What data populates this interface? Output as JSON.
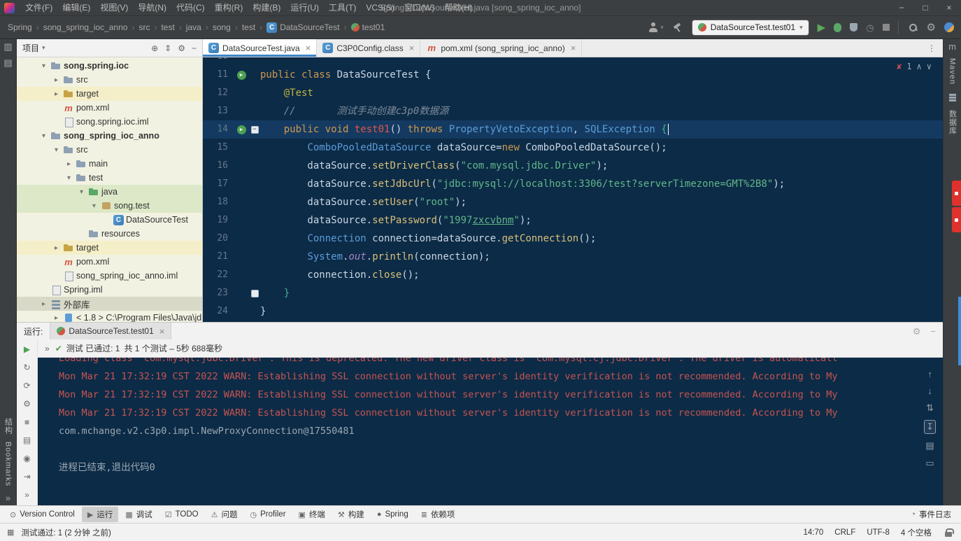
{
  "colors": {
    "ui_dark": "#3C3F41",
    "panel_light": "#F2F2F2",
    "tree_bg": "#F2F2E2",
    "editor_bg": "#0C2B47",
    "current_line": "#143A61",
    "accent_blue": "#3E86C7",
    "run_green": "#4DA152",
    "error_red": "#C75450",
    "string_green": "#61B689",
    "keyword_orange": "#D09A4E",
    "type_blue": "#5C9CD8",
    "test_row_green": "#DCE8C7",
    "excluded_row_yellow": "#F5EFC9"
  },
  "window": {
    "title": "Spring - DataSourceTest.java [song_spring_ioc_anno]",
    "menus": [
      "文件(F)",
      "编辑(E)",
      "视图(V)",
      "导航(N)",
      "代码(C)",
      "重构(R)",
      "构建(B)",
      "运行(U)",
      "工具(T)",
      "VCS(S)",
      "窗口(W)",
      "帮助(H)"
    ],
    "buttons": {
      "minimize": "−",
      "restore": "□",
      "close": "×"
    }
  },
  "navbar": {
    "breadcrumbs": [
      {
        "label": "Spring"
      },
      {
        "label": "song_spring_ioc_anno"
      },
      {
        "label": "src"
      },
      {
        "label": "test"
      },
      {
        "label": "java"
      },
      {
        "label": "song"
      },
      {
        "label": "test"
      },
      {
        "label": "DataSourceTest",
        "icon": "class"
      },
      {
        "label": "test01",
        "icon": "testm"
      }
    ],
    "run_config": "DataSourceTest.test01"
  },
  "left_stripe": {
    "top_icons": [
      {
        "name": "project-tool-icon",
        "g": "▥"
      },
      {
        "name": "commit-tool-icon",
        "g": "▤"
      }
    ],
    "labels": [
      {
        "name": "structure-tool-button",
        "t": "结构"
      },
      {
        "name": "bookmarks-tool-button",
        "t": "Bookmarks"
      }
    ],
    "more": "»"
  },
  "right_stripe": {
    "maven_icon": "m",
    "labels": [
      {
        "name": "maven-tool-button",
        "t": "Maven"
      },
      {
        "name": "database-tool-button",
        "t": "数据库"
      }
    ]
  },
  "project": {
    "title": "项目",
    "header_icons": [
      {
        "name": "locate-file-icon",
        "g": "⊕"
      },
      {
        "name": "expand-collapse-icon",
        "g": "⇕"
      },
      {
        "name": "settings-gear-icon",
        "g": "⚙"
      },
      {
        "name": "hide-panel-icon",
        "g": "−"
      }
    ],
    "tree": [
      {
        "label": "song.spring.ioc",
        "lvl": 1,
        "chev": "v",
        "icon": "folder",
        "bold": true
      },
      {
        "label": "src",
        "lvl": 2,
        "chev": ">",
        "icon": "folder"
      },
      {
        "label": "target",
        "lvl": 2,
        "chev": ">",
        "icon": "folder-x",
        "row": "excl"
      },
      {
        "label": "pom.xml",
        "lvl": 2,
        "chev": "",
        "icon": "maven"
      },
      {
        "label": "song.spring.ioc.iml",
        "lvl": 2,
        "chev": "",
        "icon": "iml"
      },
      {
        "label": "song_spring_ioc_anno",
        "lvl": 1,
        "chev": "v",
        "icon": "folder",
        "bold": true
      },
      {
        "label": "src",
        "lvl": 2,
        "chev": "v",
        "icon": "folder"
      },
      {
        "label": "main",
        "lvl": 3,
        "chev": ">",
        "icon": "folder"
      },
      {
        "label": "test",
        "lvl": 3,
        "chev": "v",
        "icon": "folder"
      },
      {
        "label": "java",
        "lvl": 4,
        "chev": "v",
        "icon": "folder-g",
        "row": "test"
      },
      {
        "label": "song.test",
        "lvl": 5,
        "chev": "v",
        "icon": "package",
        "row": "test"
      },
      {
        "label": "DataSourceTest",
        "lvl": 6,
        "chev": "",
        "icon": "class"
      },
      {
        "label": "resources",
        "lvl": 4,
        "chev": "",
        "icon": "folder-r"
      },
      {
        "label": "target",
        "lvl": 2,
        "chev": ">",
        "icon": "folder-x",
        "row": "excl"
      },
      {
        "label": "pom.xml",
        "lvl": 2,
        "chev": "",
        "icon": "maven"
      },
      {
        "label": "song_spring_ioc_anno.iml",
        "lvl": 2,
        "chev": "",
        "icon": "iml"
      },
      {
        "label": "Spring.iml",
        "lvl": 1,
        "chev": "",
        "icon": "iml"
      },
      {
        "label": "外部库",
        "lvl": 1,
        "chev": ">",
        "icon": "lib",
        "row": "lib"
      },
      {
        "label": "< 1.8 > C:\\Program Files\\Java\\jd",
        "lvl": 2,
        "chev": ">",
        "icon": "jdk"
      }
    ]
  },
  "editor": {
    "tabs": [
      {
        "title": "DataSourceTest.java",
        "icon": "class",
        "active": true
      },
      {
        "title": "C3P0Config.class",
        "icon": "class",
        "active": false
      },
      {
        "title": "pom.xml (song_spring_ioc_anno)",
        "icon": "maven",
        "active": false
      }
    ],
    "tab_more": "⋮",
    "inspection": {
      "count": "1",
      "up": "∧",
      "down": "∨"
    },
    "lines": [
      {
        "n": "10",
        "t": []
      },
      {
        "n": "11",
        "run": true,
        "t": [
          [
            "kw",
            "public class "
          ],
          [
            "pl",
            "DataSourceTest {"
          ]
        ]
      },
      {
        "n": "12",
        "t": [
          [
            "pl",
            "    "
          ],
          [
            "ann",
            "@Test"
          ]
        ]
      },
      {
        "n": "13",
        "t": [
          [
            "pl",
            "    "
          ],
          [
            "cm",
            "//       测试手动创建c3p0数据源"
          ]
        ]
      },
      {
        "n": "14",
        "run": true,
        "cur": true,
        "fold": "-",
        "caret": true,
        "t": [
          [
            "pl",
            "    "
          ],
          [
            "kw",
            "public void "
          ],
          [
            "mdecl",
            "test01"
          ],
          [
            "pl",
            "() "
          ],
          [
            "kw",
            "throws "
          ],
          [
            "ty",
            "PropertyVetoException"
          ],
          [
            "pl",
            ", "
          ],
          [
            "ty",
            "SQLException"
          ],
          [
            "pl",
            " "
          ],
          [
            "br",
            "{"
          ]
        ]
      },
      {
        "n": "15",
        "t": [
          [
            "pl",
            "        "
          ],
          [
            "ty",
            "ComboPooledDataSource"
          ],
          [
            "pl",
            " dataSource="
          ],
          [
            "kw",
            "new"
          ],
          [
            "pl",
            " ComboPooledDataSource();"
          ]
        ]
      },
      {
        "n": "16",
        "t": [
          [
            "pl",
            "        dataSource."
          ],
          [
            "mc",
            "setDriverClass"
          ],
          [
            "pl",
            "("
          ],
          [
            "st",
            "\"com.mysql.jdbc.Driver\""
          ],
          [
            "pl",
            ");"
          ]
        ]
      },
      {
        "n": "17",
        "t": [
          [
            "pl",
            "        dataSource."
          ],
          [
            "mc",
            "setJdbcUrl"
          ],
          [
            "pl",
            "("
          ],
          [
            "st",
            "\"jdbc:mysql://localhost:3306/test?serverTimezone=GMT%2B8\""
          ],
          [
            "pl",
            ");"
          ]
        ]
      },
      {
        "n": "18",
        "t": [
          [
            "pl",
            "        dataSource."
          ],
          [
            "mc",
            "setUser"
          ],
          [
            "pl",
            "("
          ],
          [
            "st",
            "\"root\""
          ],
          [
            "pl",
            ");"
          ]
        ]
      },
      {
        "n": "19",
        "t": [
          [
            "pl",
            "        dataSource."
          ],
          [
            "mc",
            "setPassword"
          ],
          [
            "pl",
            "("
          ],
          [
            "st",
            "\"1997"
          ],
          [
            "stu",
            "zxcvbnm"
          ],
          [
            "st",
            "\""
          ],
          [
            "pl",
            ");"
          ]
        ]
      },
      {
        "n": "20",
        "t": [
          [
            "pl",
            "        "
          ],
          [
            "ty",
            "Connection"
          ],
          [
            "pl",
            " connection=dataSource."
          ],
          [
            "mc",
            "getConnection"
          ],
          [
            "pl",
            "();"
          ]
        ]
      },
      {
        "n": "21",
        "t": [
          [
            "pl",
            "        "
          ],
          [
            "ty",
            "System"
          ],
          [
            "pl",
            "."
          ],
          [
            "fld",
            "out"
          ],
          [
            "pl",
            "."
          ],
          [
            "mc",
            "println"
          ],
          [
            "pl",
            "(connection);"
          ]
        ]
      },
      {
        "n": "22",
        "t": [
          [
            "pl",
            "        connection."
          ],
          [
            "mc",
            "close"
          ],
          [
            "pl",
            "();"
          ]
        ]
      },
      {
        "n": "23",
        "fold": "end",
        "t": [
          [
            "pl",
            "    "
          ],
          [
            "br",
            "}"
          ]
        ]
      },
      {
        "n": "24",
        "t": [
          [
            "pl",
            "}"
          ]
        ]
      }
    ]
  },
  "run_panel": {
    "label": "运行:",
    "tab": "DataSourceTest.test01",
    "tab_close": "×",
    "shelf": "»",
    "status_left": "测试 已通过: 1",
    "status_right": "共 1 个测试 – 5秒 688毫秒",
    "rail_left": [
      {
        "name": "rerun-tests-icon",
        "g": "▶",
        "c": "#4DA152"
      },
      {
        "name": "rerun-failed-tests-icon",
        "g": "↻",
        "c": "#6E6E6E"
      },
      {
        "name": "toggle-auto-test-icon",
        "g": "⟳",
        "c": "#6E6E6E"
      },
      {
        "name": "test-settings-wrench-icon",
        "g": "⚙",
        "c": "#6E6E6E"
      },
      {
        "name": "stop-process-icon",
        "g": "■",
        "c": "#9A9A9A"
      },
      {
        "name": "thread-dump-icon",
        "g": "▤",
        "c": "#6E6E6E"
      },
      {
        "name": "screenshot-icon",
        "g": "◉",
        "c": "#6E6E6E"
      },
      {
        "name": "import-test-results-icon",
        "g": "⇥",
        "c": "#6E6E6E"
      },
      {
        "name": "more-options-icon",
        "g": "»",
        "c": "#6E6E6E"
      }
    ],
    "rail_right": [
      {
        "name": "scroll-up-icon",
        "g": "↑"
      },
      {
        "name": "scroll-down-icon",
        "g": "↓"
      },
      {
        "name": "soft-wrap-icon",
        "g": "⇅"
      },
      {
        "name": "scroll-to-end-icon",
        "g": "↧",
        "active": true
      },
      {
        "name": "print-console-icon",
        "g": "▤"
      },
      {
        "name": "clear-console-icon",
        "g": "▭"
      }
    ],
    "console": [
      {
        "c": "err",
        "clip": true,
        "text": "Loading class `com.mysql.jdbc.Driver'. This is deprecated. The new driver class is `com.mysql.cj.jdbc.Driver'. The driver is automaticall"
      },
      {
        "c": "err",
        "text": "Mon Mar 21 17:32:19 CST 2022 WARN: Establishing SSL connection without server's identity verification is not recommended. According to My"
      },
      {
        "c": "err",
        "text": "Mon Mar 21 17:32:19 CST 2022 WARN: Establishing SSL connection without server's identity verification is not recommended. According to My"
      },
      {
        "c": "err",
        "text": "Mon Mar 21 17:32:19 CST 2022 WARN: Establishing SSL connection without server's identity verification is not recommended. According to My"
      },
      {
        "c": "out",
        "text": "com.mchange.v2.c3p0.impl.NewProxyConnection@17550481"
      },
      {
        "c": "out",
        "text": ""
      },
      {
        "c": "out",
        "text": "进程已结束,退出代码0"
      }
    ]
  },
  "bottom_bar": {
    "items": [
      {
        "label": "Version Control",
        "icon": "⊙",
        "name": "version-control-tab"
      },
      {
        "label": "运行",
        "icon": "▶",
        "name": "run-tab",
        "active": true
      },
      {
        "label": "调试",
        "icon": "▦",
        "name": "debug-tab"
      },
      {
        "label": "TODO",
        "icon": "☑",
        "name": "todo-tab"
      },
      {
        "label": "问题",
        "icon": "⚠",
        "name": "problems-tab"
      },
      {
        "label": "Profiler",
        "icon": "◷",
        "name": "profiler-tab"
      },
      {
        "label": "终端",
        "icon": "▣",
        "name": "terminal-tab"
      },
      {
        "label": "构建",
        "icon": "⚒",
        "name": "build-tab"
      },
      {
        "label": "Spring",
        "icon": "●",
        "name": "spring-tab"
      },
      {
        "label": "依赖项",
        "icon": "≣",
        "name": "dependencies-tab"
      }
    ],
    "right_label": "事件日志"
  },
  "status_bar": {
    "message": "测试通过: 1 (2 分钟 之前)",
    "items": [
      {
        "name": "caret-position",
        "t": "14:70"
      },
      {
        "name": "line-separator",
        "t": "CRLF"
      },
      {
        "name": "file-encoding",
        "t": "UTF-8"
      },
      {
        "name": "indent-config",
        "t": "4 个空格"
      }
    ]
  }
}
